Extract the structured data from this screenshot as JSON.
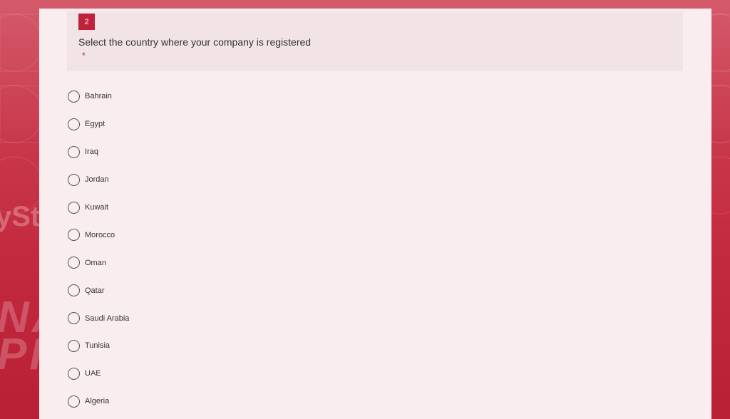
{
  "question": {
    "number": "2",
    "title": "Select the country where your company is registered",
    "required_marker": "*"
  },
  "options": [
    {
      "label": "Bahrain",
      "selected": false
    },
    {
      "label": "Egypt",
      "selected": false
    },
    {
      "label": "Iraq",
      "selected": false
    },
    {
      "label": "Jordan",
      "selected": false
    },
    {
      "label": "Kuwait",
      "selected": false
    },
    {
      "label": "Morocco",
      "selected": false
    },
    {
      "label": "Oman",
      "selected": false
    },
    {
      "label": "Qatar",
      "selected": false
    },
    {
      "label": "Saudi Arabia",
      "selected": false
    },
    {
      "label": "Tunisia",
      "selected": false
    },
    {
      "label": "UAE",
      "selected": false
    },
    {
      "label": "Algeria",
      "selected": false
    }
  ],
  "background": {
    "brand_text": "yStation",
    "brand_text_2": "NA ERO\nPROJECT"
  },
  "colors": {
    "accent": "#c0213a",
    "card": "#faedf0",
    "header": "#f1e3e6"
  }
}
